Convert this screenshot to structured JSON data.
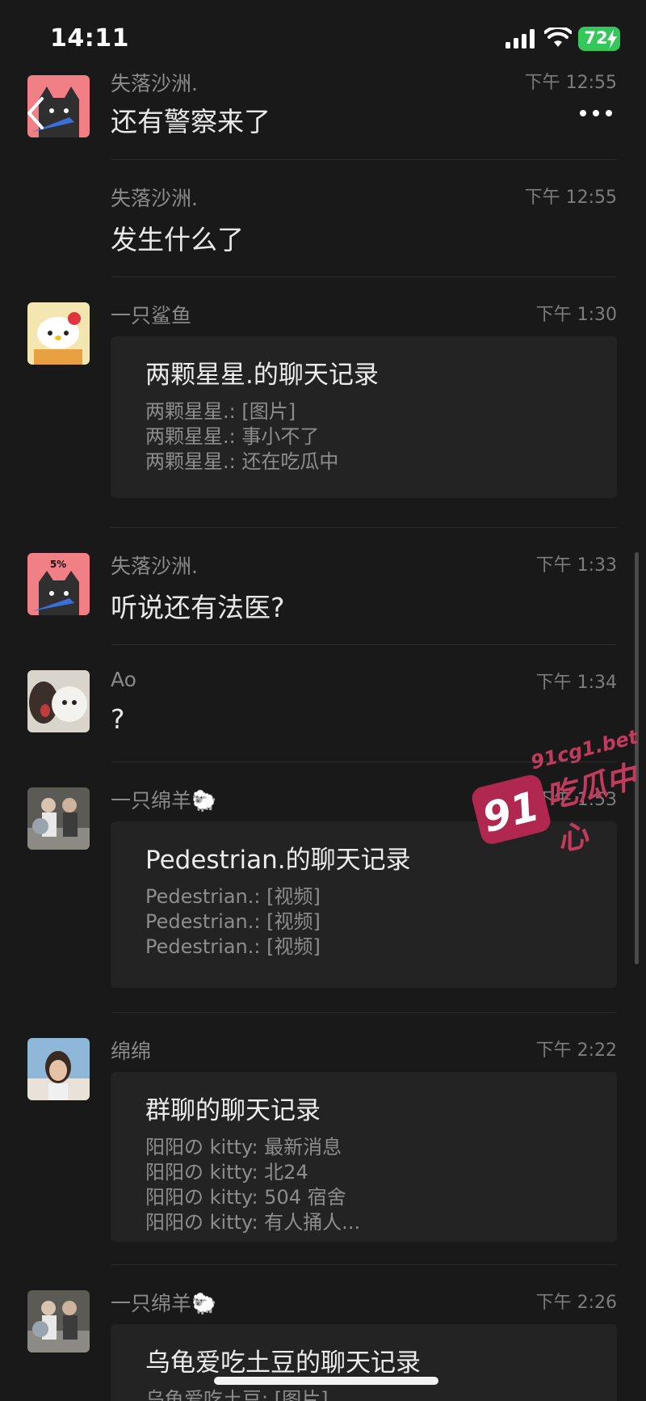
{
  "status_bar": {
    "time": "14:11",
    "battery": "72"
  },
  "messages": [
    {
      "sender": "失落沙洲.",
      "time": "下午 12:55",
      "text": "还有警察来了"
    },
    {
      "sender": "失落沙洲.",
      "time": "下午 12:55",
      "text": "发生什么了"
    },
    {
      "sender": "一只鲨鱼",
      "time": "下午 1:30",
      "card": {
        "title": "两颗星星.的聊天记录",
        "lines": [
          "两颗星星.: [图片]",
          "两颗星星.: 事小不了",
          "两颗星星.: 还在吃瓜中"
        ]
      }
    },
    {
      "sender": "失落沙洲.",
      "time": "下午 1:33",
      "text": "听说还有法医?"
    },
    {
      "sender": "Ao",
      "time": "下午 1:34",
      "text": "?"
    },
    {
      "sender": "一只绵羊🐑",
      "time": "下午 1:53",
      "card": {
        "title": "Pedestrian.的聊天记录",
        "lines": [
          "Pedestrian.: [视频]",
          "Pedestrian.: [视频]",
          "Pedestrian.: [视频]"
        ]
      }
    },
    {
      "sender": "绵绵",
      "time": "下午 2:22",
      "card": {
        "title": "群聊的聊天记录",
        "lines": [
          "阳阳の kitty: 最新消息",
          "阳阳の kitty: 北24",
          "阳阳の kitty: 504 宿舍",
          "阳阳の kitty: 有人捅人..."
        ]
      }
    },
    {
      "sender": "一只绵羊🐑",
      "time": "下午 2:26",
      "card": {
        "title": "乌龟爱吃土豆的聊天记录",
        "lines": [
          "乌龟爱吃土豆: [图片]"
        ]
      }
    }
  ],
  "watermark": {
    "badge": "91",
    "url": "91cg1.bet",
    "name": "吃瓜中心"
  },
  "colors": {
    "background": "#191919",
    "card": "#232323",
    "battery": "#34c759",
    "watermark": "#b0274f"
  }
}
